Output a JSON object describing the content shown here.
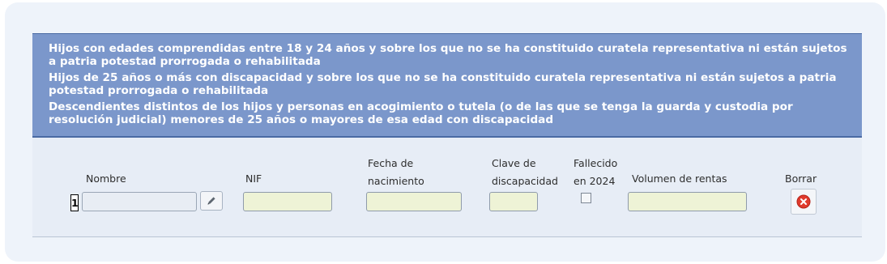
{
  "header": {
    "lines": [
      "Hijos con edades comprendidas entre 18 y 24 años y sobre los que no se ha constituido curatela representativa ni están sujetos a patria potestad prorrogada o rehabilitada",
      "Hijos de 25 años o más con discapacidad y sobre los que no se ha constituido curatela representativa ni están sujetos a patria potestad prorrogada o rehabilitada",
      "Descendientes distintos de los hijos y personas en acogimiento o tutela (o de las que se tenga la guarda y custodia por resolución judicial) menores de 25 años o mayores de esa edad con discapacidad"
    ]
  },
  "columns": {
    "nombre": "Nombre",
    "nif": "NIF",
    "fecha_line1": "Fecha de",
    "fecha_line2": "nacimiento",
    "clave_line1": "Clave de",
    "clave_line2": "discapacidad",
    "fallecido_line1": "Fallecido",
    "fallecido_line2": "en 2024",
    "rentas": "Volumen de rentas",
    "borrar": "Borrar"
  },
  "row": {
    "number": "1",
    "nombre": "",
    "nif": "",
    "fecha_nacimiento": "",
    "clave_discapacidad": "",
    "fallecido": false,
    "volumen_rentas": ""
  },
  "icons": {
    "edit": "pencil-icon",
    "delete": "delete-x-icon"
  },
  "colors": {
    "header_bg": "#7b97cb",
    "input_bg": "#eef3d6",
    "delete_red": "#e03a2c"
  }
}
